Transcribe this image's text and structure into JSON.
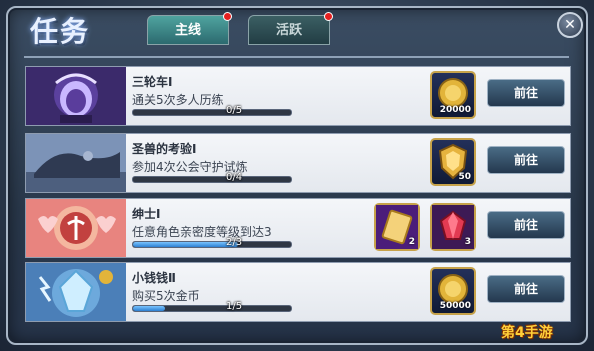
{
  "window": {
    "title": "任务",
    "close_glyph": "✕"
  },
  "tabs": [
    {
      "label": "主线",
      "has_badge": true
    },
    {
      "label": "活跃",
      "has_badge": true
    }
  ],
  "quests": [
    {
      "title": "三轮车Ⅰ",
      "desc": "通关5次多人历练",
      "progress_text": "0/5",
      "progress": 0.0,
      "rewards": [
        {
          "icon": "gold-coin-icon",
          "count": "20000"
        }
      ],
      "button_label": "前往"
    },
    {
      "title": "圣兽的考验Ⅰ",
      "desc": "参加4次公会守护试炼",
      "progress_text": "0/4",
      "progress": 0.0,
      "rewards": [
        {
          "icon": "shield-emblem-icon",
          "count": "50"
        }
      ],
      "button_label": "前往"
    },
    {
      "title": "绅士Ⅰ",
      "desc": "任意角色亲密度等级到达3",
      "progress_text": "2/3",
      "progress": 0.667,
      "rewards": [
        {
          "icon": "ticket-icon",
          "count": "2"
        },
        {
          "icon": "red-gem-icon",
          "count": "3"
        }
      ],
      "button_label": "前往"
    },
    {
      "title": "小钱钱Ⅱ",
      "desc": "购买5次金币",
      "progress_text": "1/5",
      "progress": 0.2,
      "rewards": [
        {
          "icon": "gold-coin-icon",
          "count": "50000"
        }
      ],
      "button_label": "前往"
    }
  ],
  "watermark": "第4手游",
  "colors": {
    "tab_main": "#2c6a6f",
    "badge": "#e52020",
    "progress": "#2c7fd1"
  }
}
